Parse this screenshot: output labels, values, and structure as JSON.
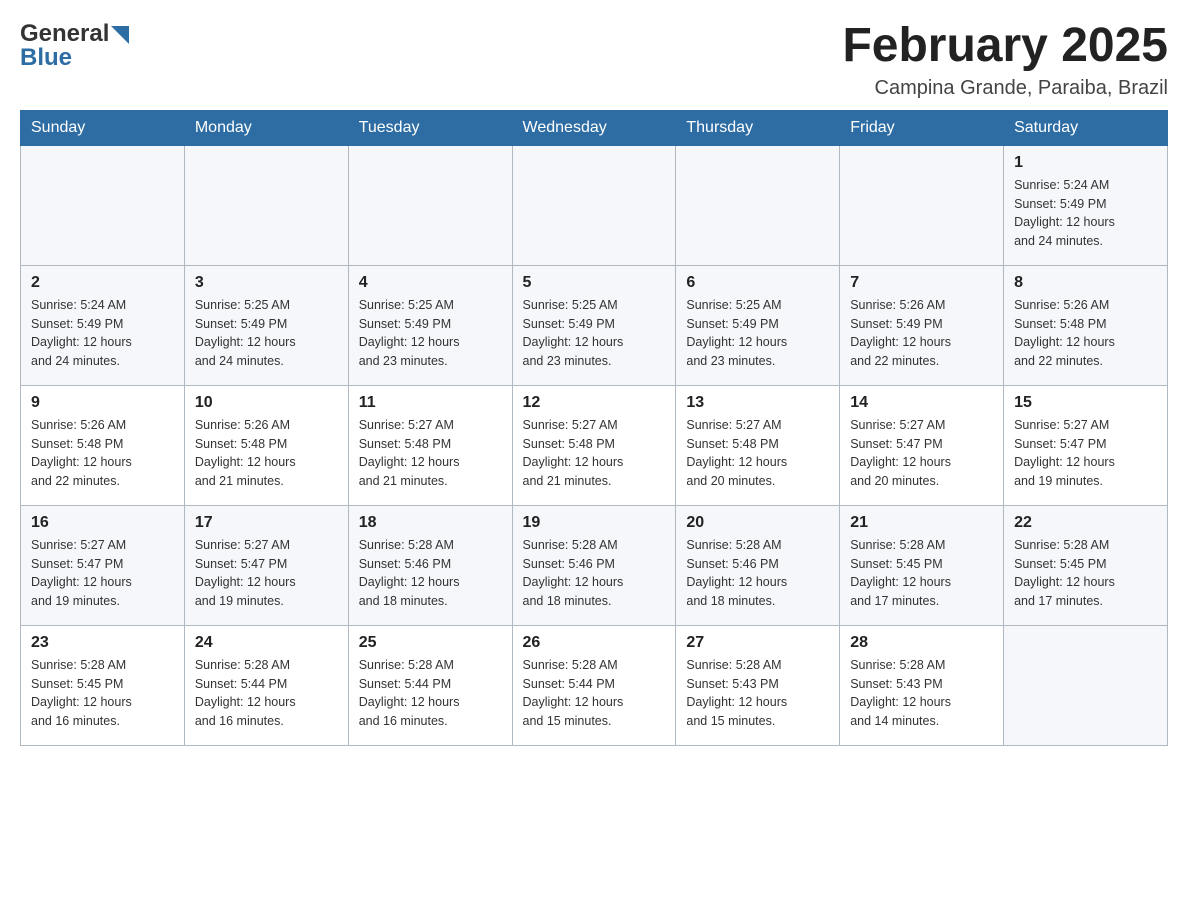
{
  "header": {
    "logo_general": "General",
    "logo_blue": "Blue",
    "month_title": "February 2025",
    "location": "Campina Grande, Paraiba, Brazil"
  },
  "weekdays": [
    "Sunday",
    "Monday",
    "Tuesday",
    "Wednesday",
    "Thursday",
    "Friday",
    "Saturday"
  ],
  "weeks": [
    [
      {
        "day": "",
        "info": ""
      },
      {
        "day": "",
        "info": ""
      },
      {
        "day": "",
        "info": ""
      },
      {
        "day": "",
        "info": ""
      },
      {
        "day": "",
        "info": ""
      },
      {
        "day": "",
        "info": ""
      },
      {
        "day": "1",
        "info": "Sunrise: 5:24 AM\nSunset: 5:49 PM\nDaylight: 12 hours\nand 24 minutes."
      }
    ],
    [
      {
        "day": "2",
        "info": "Sunrise: 5:24 AM\nSunset: 5:49 PM\nDaylight: 12 hours\nand 24 minutes."
      },
      {
        "day": "3",
        "info": "Sunrise: 5:25 AM\nSunset: 5:49 PM\nDaylight: 12 hours\nand 24 minutes."
      },
      {
        "day": "4",
        "info": "Sunrise: 5:25 AM\nSunset: 5:49 PM\nDaylight: 12 hours\nand 23 minutes."
      },
      {
        "day": "5",
        "info": "Sunrise: 5:25 AM\nSunset: 5:49 PM\nDaylight: 12 hours\nand 23 minutes."
      },
      {
        "day": "6",
        "info": "Sunrise: 5:25 AM\nSunset: 5:49 PM\nDaylight: 12 hours\nand 23 minutes."
      },
      {
        "day": "7",
        "info": "Sunrise: 5:26 AM\nSunset: 5:49 PM\nDaylight: 12 hours\nand 22 minutes."
      },
      {
        "day": "8",
        "info": "Sunrise: 5:26 AM\nSunset: 5:48 PM\nDaylight: 12 hours\nand 22 minutes."
      }
    ],
    [
      {
        "day": "9",
        "info": "Sunrise: 5:26 AM\nSunset: 5:48 PM\nDaylight: 12 hours\nand 22 minutes."
      },
      {
        "day": "10",
        "info": "Sunrise: 5:26 AM\nSunset: 5:48 PM\nDaylight: 12 hours\nand 21 minutes."
      },
      {
        "day": "11",
        "info": "Sunrise: 5:27 AM\nSunset: 5:48 PM\nDaylight: 12 hours\nand 21 minutes."
      },
      {
        "day": "12",
        "info": "Sunrise: 5:27 AM\nSunset: 5:48 PM\nDaylight: 12 hours\nand 21 minutes."
      },
      {
        "day": "13",
        "info": "Sunrise: 5:27 AM\nSunset: 5:48 PM\nDaylight: 12 hours\nand 20 minutes."
      },
      {
        "day": "14",
        "info": "Sunrise: 5:27 AM\nSunset: 5:47 PM\nDaylight: 12 hours\nand 20 minutes."
      },
      {
        "day": "15",
        "info": "Sunrise: 5:27 AM\nSunset: 5:47 PM\nDaylight: 12 hours\nand 19 minutes."
      }
    ],
    [
      {
        "day": "16",
        "info": "Sunrise: 5:27 AM\nSunset: 5:47 PM\nDaylight: 12 hours\nand 19 minutes."
      },
      {
        "day": "17",
        "info": "Sunrise: 5:27 AM\nSunset: 5:47 PM\nDaylight: 12 hours\nand 19 minutes."
      },
      {
        "day": "18",
        "info": "Sunrise: 5:28 AM\nSunset: 5:46 PM\nDaylight: 12 hours\nand 18 minutes."
      },
      {
        "day": "19",
        "info": "Sunrise: 5:28 AM\nSunset: 5:46 PM\nDaylight: 12 hours\nand 18 minutes."
      },
      {
        "day": "20",
        "info": "Sunrise: 5:28 AM\nSunset: 5:46 PM\nDaylight: 12 hours\nand 18 minutes."
      },
      {
        "day": "21",
        "info": "Sunrise: 5:28 AM\nSunset: 5:45 PM\nDaylight: 12 hours\nand 17 minutes."
      },
      {
        "day": "22",
        "info": "Sunrise: 5:28 AM\nSunset: 5:45 PM\nDaylight: 12 hours\nand 17 minutes."
      }
    ],
    [
      {
        "day": "23",
        "info": "Sunrise: 5:28 AM\nSunset: 5:45 PM\nDaylight: 12 hours\nand 16 minutes."
      },
      {
        "day": "24",
        "info": "Sunrise: 5:28 AM\nSunset: 5:44 PM\nDaylight: 12 hours\nand 16 minutes."
      },
      {
        "day": "25",
        "info": "Sunrise: 5:28 AM\nSunset: 5:44 PM\nDaylight: 12 hours\nand 16 minutes."
      },
      {
        "day": "26",
        "info": "Sunrise: 5:28 AM\nSunset: 5:44 PM\nDaylight: 12 hours\nand 15 minutes."
      },
      {
        "day": "27",
        "info": "Sunrise: 5:28 AM\nSunset: 5:43 PM\nDaylight: 12 hours\nand 15 minutes."
      },
      {
        "day": "28",
        "info": "Sunrise: 5:28 AM\nSunset: 5:43 PM\nDaylight: 12 hours\nand 14 minutes."
      },
      {
        "day": "",
        "info": ""
      }
    ]
  ]
}
